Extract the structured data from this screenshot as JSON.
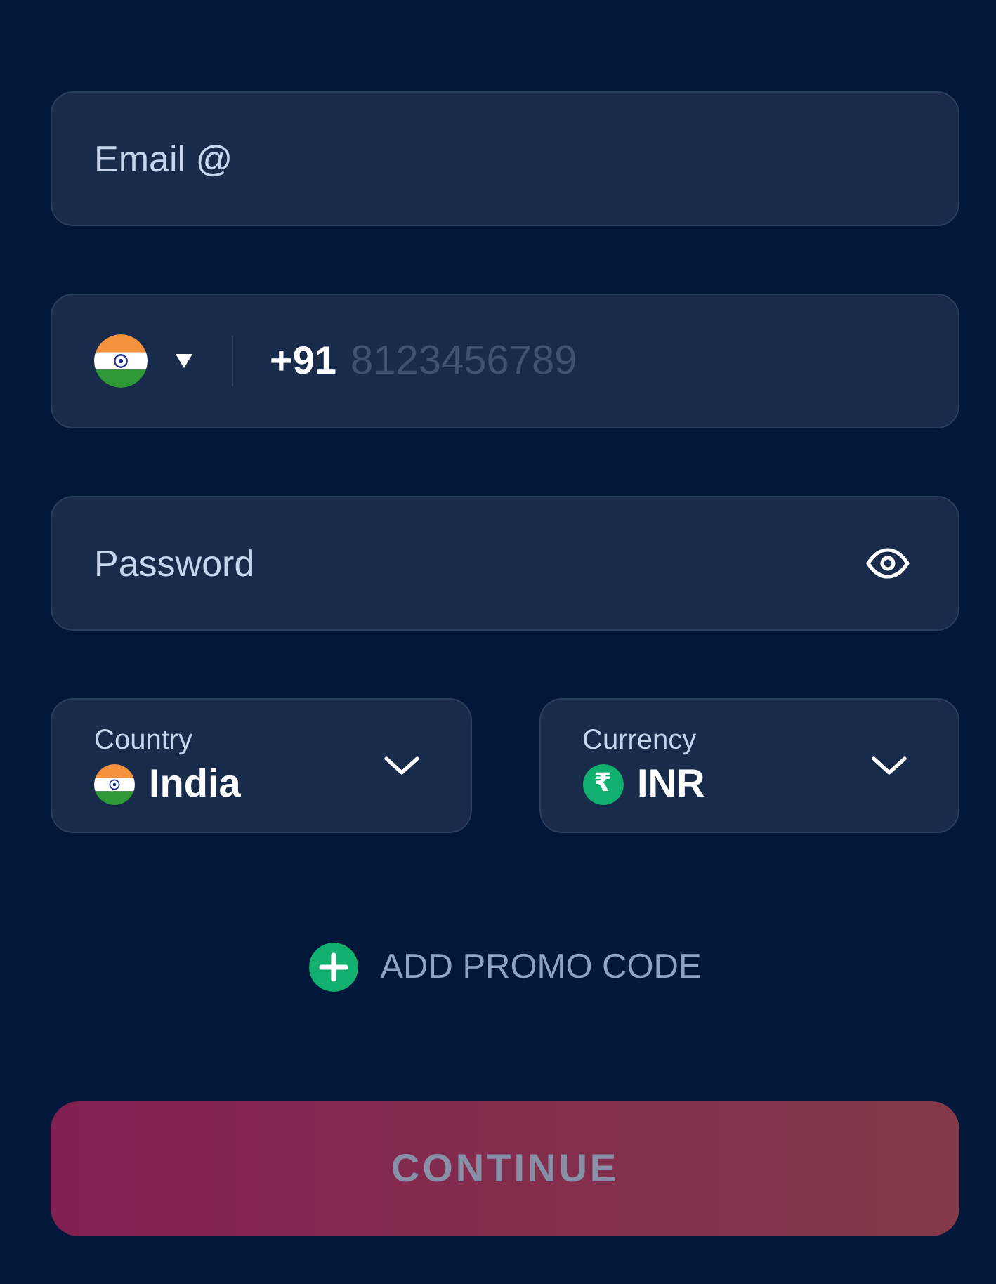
{
  "email": {
    "placeholder": "Email @"
  },
  "phone": {
    "country_code": "+91",
    "placeholder": "8123456789"
  },
  "password": {
    "placeholder": "Password"
  },
  "selects": [
    {
      "kind": "country",
      "label": "Country",
      "value": "India"
    },
    {
      "kind": "currency",
      "label": "Currency",
      "value": "INR",
      "symbol": "₹"
    }
  ],
  "promo": {
    "label": "ADD PROMO CODE"
  },
  "continue_button": {
    "label": "CONTINUE",
    "disabled": true
  }
}
